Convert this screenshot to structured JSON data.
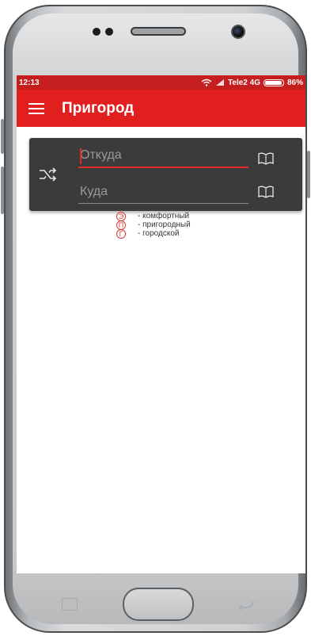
{
  "status_bar": {
    "time": "12:13",
    "carrier": "Tele2 4G",
    "battery": "86%"
  },
  "app_bar": {
    "title": "Пригород",
    "menu_icon": "hamburger-menu-icon"
  },
  "route_form": {
    "from_placeholder": "Откуда",
    "to_placeholder": "Куда",
    "swap_icon": "shuffle-icon",
    "book_icon": "book-icon"
  },
  "legend": [
    {
      "badge": "Э",
      "text": "- комфортный"
    },
    {
      "badge": "П",
      "text": "- пригородный"
    },
    {
      "badge": "Г",
      "text": "- городской"
    }
  ],
  "colors": {
    "accent": "#e21f1f",
    "status_bar": "#c41e1e",
    "card": "#3b3b3b",
    "badge": "#d23a3a"
  }
}
